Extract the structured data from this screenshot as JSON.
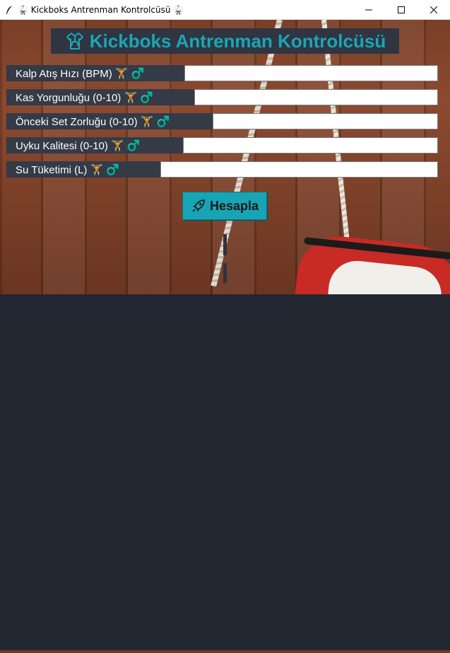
{
  "window": {
    "title": "🥋 Kickboks Antrenman Kontrolcüsü 🥋"
  },
  "header": {
    "title": "Kickboks Antrenman Kontrolcüsü"
  },
  "fields": [
    {
      "label": "Kalp Atış Hızı (BPM) 🏋️ ♂️",
      "value": ""
    },
    {
      "label": "Kas Yorgunluğu (0-10) 🏋️ ♂️",
      "value": ""
    },
    {
      "label": "Önceki Set Zorluğu (0-10) 🏋️ ♂️",
      "value": ""
    },
    {
      "label": "Uyku Kalitesi (0-10) 🏋️ ♂️",
      "value": ""
    },
    {
      "label": "Su Tüketimi (L) 🏋️ ♂️",
      "value": ""
    }
  ],
  "button": {
    "label": "Hesapla"
  },
  "colors": {
    "accent": "#1aa6b7",
    "panel": "#343a46",
    "background": "#212631"
  },
  "icons": {
    "app": "feather-icon",
    "header": "martial-arts-uniform-icon",
    "button": "rocket-icon"
  }
}
